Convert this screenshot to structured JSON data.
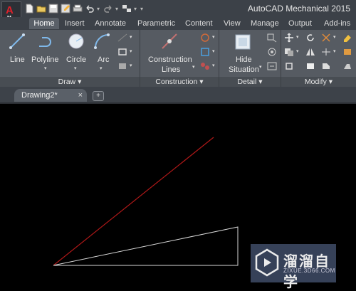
{
  "app": {
    "title": "AutoCAD Mechanical 2015",
    "logo_letter": "A",
    "logo_sub": "M"
  },
  "quick_access": [
    "new-icon",
    "open-icon",
    "save-icon",
    "save-as-icon",
    "print-icon",
    "undo-icon",
    "redo-icon",
    "workspace-icon",
    "more-icon"
  ],
  "tabs": [
    "Home",
    "Insert",
    "Annotate",
    "Parametric",
    "Content",
    "View",
    "Manage",
    "Output",
    "Add-ins"
  ],
  "active_tab": "Home",
  "ribbon": {
    "draw": {
      "title": "Draw",
      "line": "Line",
      "polyline": "Polyline",
      "circle": "Circle",
      "arc": "Arc"
    },
    "construction": {
      "title": "Construction",
      "lines": "Construction Lines",
      "lines_l1": "Construction",
      "lines_l2": "Lines"
    },
    "detail": {
      "title": "Detail",
      "hide_l1": "Hide",
      "hide_l2": "Situation"
    },
    "modify": {
      "title": "Modify"
    }
  },
  "document": {
    "tab_label": "Drawing2*",
    "close": "×",
    "new_tab": "+"
  },
  "watermark": {
    "name": "溜溜自学",
    "url": "ZIXUE.3D66.COM"
  },
  "colors": {
    "ribbon": "#565b62",
    "titlebar": "#3c4148",
    "canvas": "#000000",
    "red_line": "#b01818",
    "white_line": "#d8d8d8"
  }
}
